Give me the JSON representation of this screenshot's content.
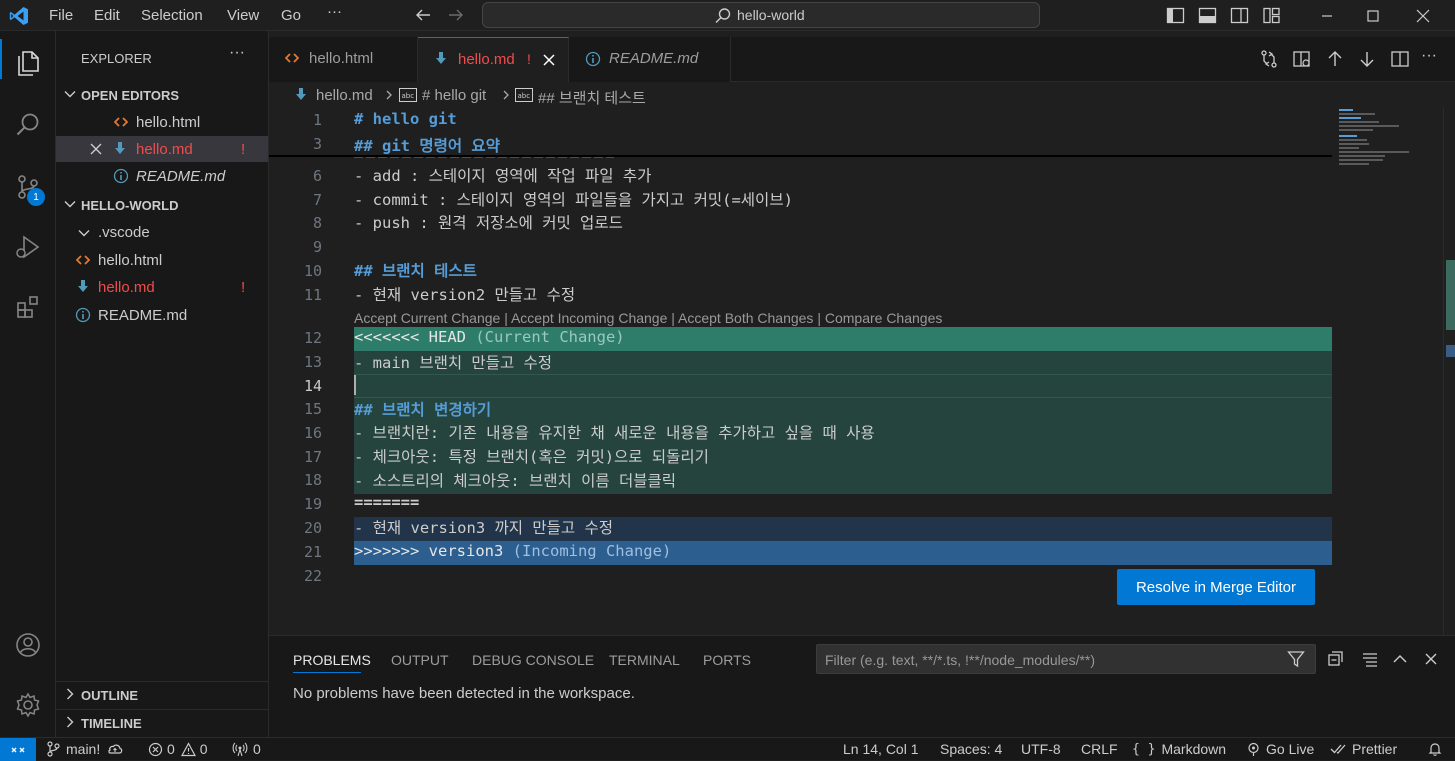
{
  "titlebar": {
    "menu": [
      "File",
      "Edit",
      "Selection",
      "View",
      "Go",
      "···"
    ],
    "search_text": "hello-world"
  },
  "activity": {
    "scm_badge": "1"
  },
  "sidebar": {
    "title": "EXPLORER",
    "more": "···",
    "open_editors_label": "OPEN EDITORS",
    "open_editors": [
      {
        "name": "hello.html",
        "icon": "html-file-icon"
      },
      {
        "name": "hello.md",
        "icon": "markdown-file-icon",
        "status": "!"
      },
      {
        "name": "README.md",
        "icon": "info-icon"
      }
    ],
    "workspace_label": "HELLO-WORLD",
    "files": [
      {
        "name": ".vscode"
      },
      {
        "name": "hello.html"
      },
      {
        "name": "hello.md",
        "status": "!"
      },
      {
        "name": "README.md"
      }
    ],
    "outline_label": "OUTLINE",
    "timeline_label": "TIMELINE"
  },
  "tabs": [
    {
      "name": "hello.html"
    },
    {
      "name": "hello.md",
      "status": "!"
    },
    {
      "name": "README.md"
    }
  ],
  "breadcrumb": {
    "file": "hello.md",
    "h1": "# hello git",
    "h2": "## 브랜치 테스트"
  },
  "editor": {
    "lines": [
      {
        "n": "1",
        "text": "# hello git"
      },
      {
        "n": "3",
        "text": "## git 명령어 요약"
      },
      {
        "n": "6",
        "text": "- add : 스테이지 영역에 작업 파일 추가"
      },
      {
        "n": "7",
        "text": "- commit : 스테이지 영역의 파일들을 가지고 커밋(=세이브)"
      },
      {
        "n": "8",
        "text": "- push : 원격 저장소에 커밋 업로드"
      },
      {
        "n": "9",
        "text": ""
      },
      {
        "n": "10",
        "text": "## 브랜치 테스트"
      },
      {
        "n": "11",
        "text": "- 현재 version2 만들고 수정"
      },
      {
        "n": "12",
        "text": "<<<<<<< HEAD",
        "note": "(Current Change)"
      },
      {
        "n": "13",
        "text": "- main 브랜치 만들고 수정"
      },
      {
        "n": "14",
        "text": ""
      },
      {
        "n": "15",
        "text": "## 브랜치 변경하기"
      },
      {
        "n": "16",
        "text": "- 브랜치란: 기존 내용을 유지한 채 새로운 내용을 추가하고 싶을 때 사용"
      },
      {
        "n": "17",
        "text": "- 체크아웃: 특정 브랜치(혹은 커밋)으로 되돌리기"
      },
      {
        "n": "18",
        "text": "- 소스트리의 체크아웃: 브랜치 이름 더블클릭"
      },
      {
        "n": "19",
        "text": "======="
      },
      {
        "n": "20",
        "text": "- 현재 version3 까지 만들고 수정"
      },
      {
        "n": "21",
        "text": ">>>>>>> version3",
        "note": "(Incoming Change)"
      },
      {
        "n": "22",
        "text": ""
      }
    ],
    "codelens": "Accept Current Change | Accept Incoming Change | Accept Both Changes | Compare Changes",
    "resolve_button": "Resolve in Merge Editor"
  },
  "panel": {
    "tabs": [
      "PROBLEMS",
      "OUTPUT",
      "DEBUG CONSOLE",
      "TERMINAL",
      "PORTS"
    ],
    "filter_placeholder": "Filter (e.g. text, **/*.ts, !**/node_modules/**)",
    "message": "No problems have been detected in the workspace."
  },
  "status": {
    "branch": "main!",
    "errors": "0",
    "warnings": "0",
    "ports": "0",
    "position": "Ln 14, Col 1",
    "spaces": "Spaces: 4",
    "encoding": "UTF-8",
    "eol": "CRLF",
    "language": "Markdown",
    "golive": "Go Live",
    "prettier": "Prettier"
  },
  "colors": {
    "accent": "#0078d4",
    "current_change_header": "#2e7d6b",
    "current_change_body": "#25443d",
    "incoming_change_header": "#2c5e8f",
    "incoming_change_body": "#213449",
    "modified": "#f14c4c"
  }
}
